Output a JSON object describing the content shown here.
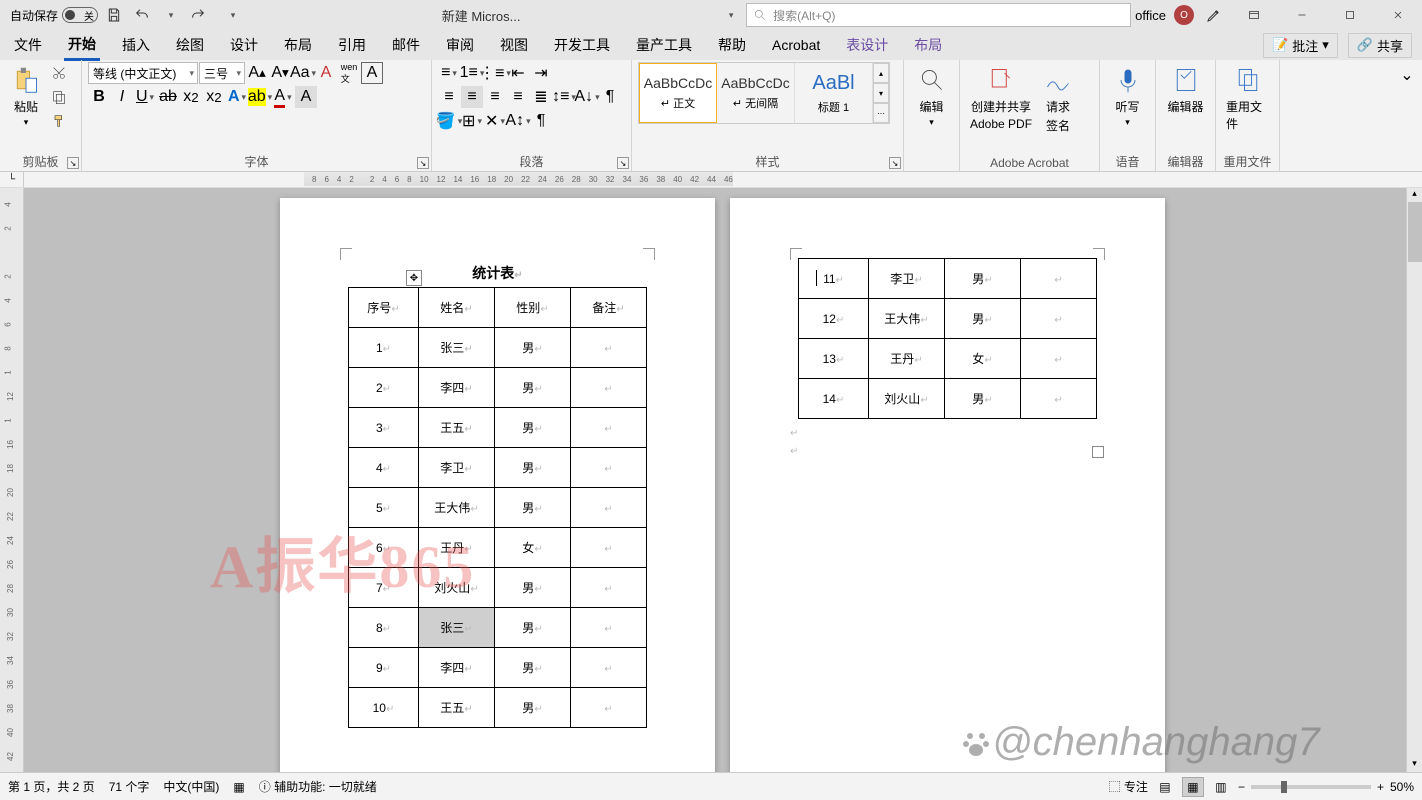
{
  "title_bar": {
    "autosave_label": "自动保存",
    "autosave_state": "关",
    "doc_title": "新建 Micros...",
    "search_placeholder": "搜索(Alt+Q)",
    "user": "office",
    "avatar_letter": "O"
  },
  "tabs": {
    "items": [
      "文件",
      "开始",
      "插入",
      "绘图",
      "设计",
      "布局",
      "引用",
      "邮件",
      "审阅",
      "视图",
      "开发工具",
      "量产工具",
      "帮助",
      "Acrobat",
      "表设计",
      "布局"
    ],
    "active_index": 1,
    "context_indices": [
      14,
      15
    ],
    "comments_btn": "批注",
    "share_btn": "共享"
  },
  "ribbon": {
    "clipboard": {
      "paste": "粘贴",
      "label": "剪贴板"
    },
    "font": {
      "name": "等线 (中文正文)",
      "size": "三号",
      "label": "字体"
    },
    "paragraph": {
      "label": "段落"
    },
    "styles": {
      "label": "样式",
      "items": [
        {
          "preview": "AaBbCcDc",
          "name": "↵ 正文"
        },
        {
          "preview": "AaBbCcDc",
          "name": "↵ 无间隔"
        },
        {
          "preview": "AaBl",
          "name": "标题 1"
        }
      ]
    },
    "editing": {
      "label": "编辑"
    },
    "acrobat": {
      "create": "创建并共享",
      "create2": "Adobe PDF",
      "sign": "请求",
      "sign2": "签名",
      "label": "Adobe Acrobat"
    },
    "voice": {
      "dictate": "听写",
      "label": "语音"
    },
    "editor": {
      "btn": "编辑器",
      "label": "编辑器"
    },
    "reuse": {
      "btn": "重用文件",
      "label": "重用文件"
    }
  },
  "hruler_marks": [
    "8",
    "6",
    "4",
    "2",
    "",
    "2",
    "4",
    "6",
    "8",
    "10",
    "12",
    "14",
    "16",
    "18",
    "20",
    "22",
    "24",
    "26",
    "28",
    "30",
    "32",
    "34",
    "36",
    "38",
    "40",
    "42",
    "44",
    "46"
  ],
  "vruler_marks": [
    "4",
    "2",
    "",
    "2",
    "4",
    "6",
    "8",
    "1",
    "12",
    "1",
    "16",
    "18",
    "20",
    "22",
    "24",
    "26",
    "28",
    "30",
    "32",
    "34",
    "36",
    "38",
    "40",
    "42"
  ],
  "document": {
    "title": "统计表",
    "headers": [
      "序号",
      "姓名",
      "性别",
      "备注"
    ],
    "rows_page1": [
      {
        "seq": "1",
        "name": "张三",
        "sex": "男",
        "note": ""
      },
      {
        "seq": "2",
        "name": "李四",
        "sex": "男",
        "note": ""
      },
      {
        "seq": "3",
        "name": "王五",
        "sex": "男",
        "note": ""
      },
      {
        "seq": "4",
        "name": "李卫",
        "sex": "男",
        "note": ""
      },
      {
        "seq": "5",
        "name": "王大伟",
        "sex": "男",
        "note": ""
      },
      {
        "seq": "6",
        "name": "王丹",
        "sex": "女",
        "note": ""
      },
      {
        "seq": "7",
        "name": "刘火山",
        "sex": "男",
        "note": ""
      },
      {
        "seq": "8",
        "name": "张三",
        "sex": "男",
        "note": ""
      },
      {
        "seq": "9",
        "name": "李四",
        "sex": "男",
        "note": ""
      },
      {
        "seq": "10",
        "name": "王五",
        "sex": "男",
        "note": ""
      }
    ],
    "rows_page2": [
      {
        "seq": "11",
        "name": "李卫",
        "sex": "男",
        "note": ""
      },
      {
        "seq": "12",
        "name": "王大伟",
        "sex": "男",
        "note": ""
      },
      {
        "seq": "13",
        "name": "王丹",
        "sex": "女",
        "note": ""
      },
      {
        "seq": "14",
        "name": "刘火山",
        "sex": "男",
        "note": ""
      }
    ],
    "selected": {
      "page": 1,
      "row_index": 7,
      "col": "name"
    }
  },
  "watermarks": {
    "wm1": "A振华865",
    "wm2": "@chenhanghang7"
  },
  "status": {
    "page": "第 1 页，共 2 页",
    "words": "71 个字",
    "lang": "中文(中国)",
    "a11y": "辅助功能: 一切就绪",
    "focus": "专注",
    "zoom": "50%"
  }
}
